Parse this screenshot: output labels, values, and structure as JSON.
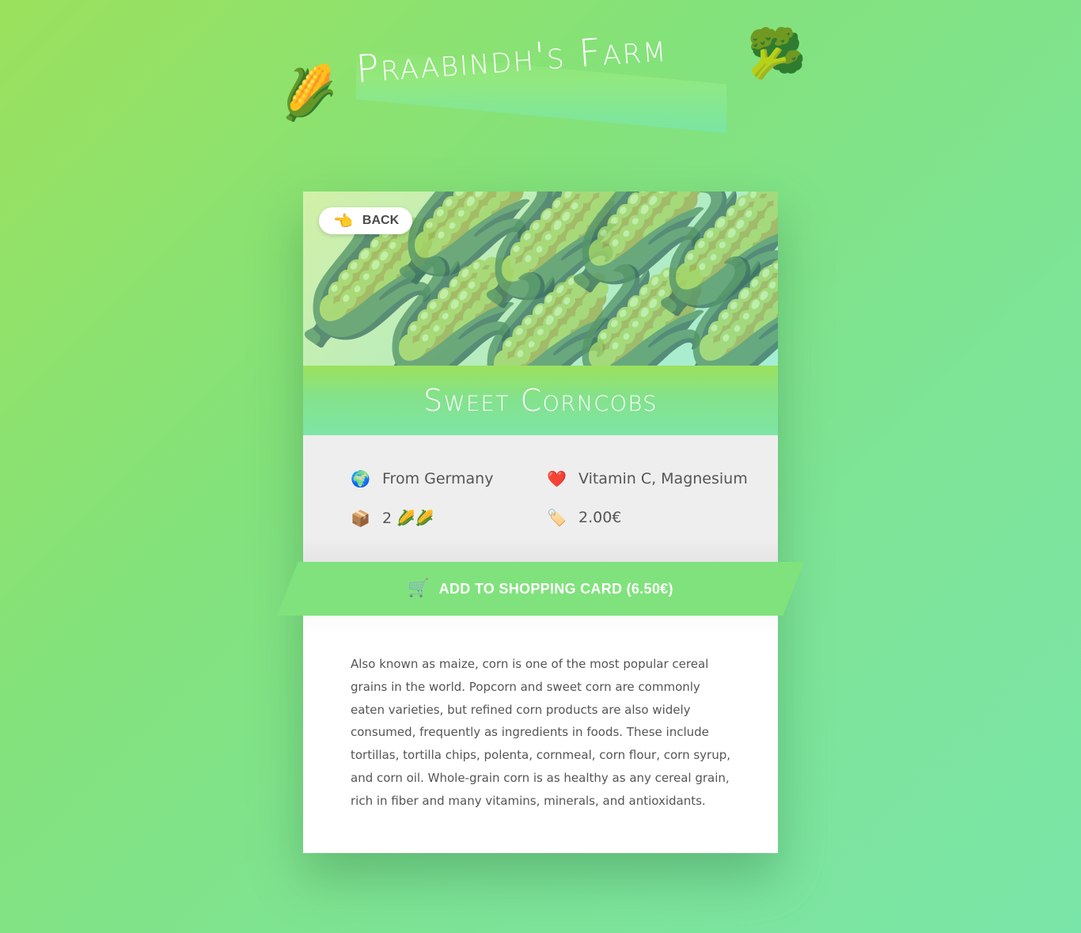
{
  "header": {
    "title": "Praabindh's Farm",
    "left_icon": "corn-icon",
    "left_emoji": "🌽",
    "right_icon": "broccoli-icon",
    "right_emoji": "🥦"
  },
  "product": {
    "back_label": "BACK",
    "back_icon": "pointing-hand-icon",
    "back_emoji": "👈",
    "name": "Sweet Corncobs",
    "origin": "From Germany",
    "origin_emoji": "🌍",
    "nutrients": "Vitamin C, Magnesium",
    "nutrients_emoji": "❤️",
    "quantity": "2 🌽🌽",
    "quantity_emoji": "📦",
    "price": "2.00€",
    "price_emoji": "🏷️",
    "cart_label": "ADD TO SHOPPING CARD (6.50€)",
    "cart_emoji": "🛒",
    "description": "Also known as maize, corn is one of the most popular cereal grains in the world. Popcorn and sweet corn are commonly eaten varieties, but refined corn products are also widely consumed, frequently as ingredients in foods. These include tortillas, tortilla chips, polenta, cornmeal, corn flour, corn syrup, and corn oil. Whole-grain corn is as healthy as any cereal grain, rich in fiber and many vitamins, minerals, and antioxidants."
  },
  "colors": {
    "accent": "#80e27c",
    "background_start": "#9be15d",
    "background_end": "#7ae5a8",
    "text": "#555555"
  }
}
